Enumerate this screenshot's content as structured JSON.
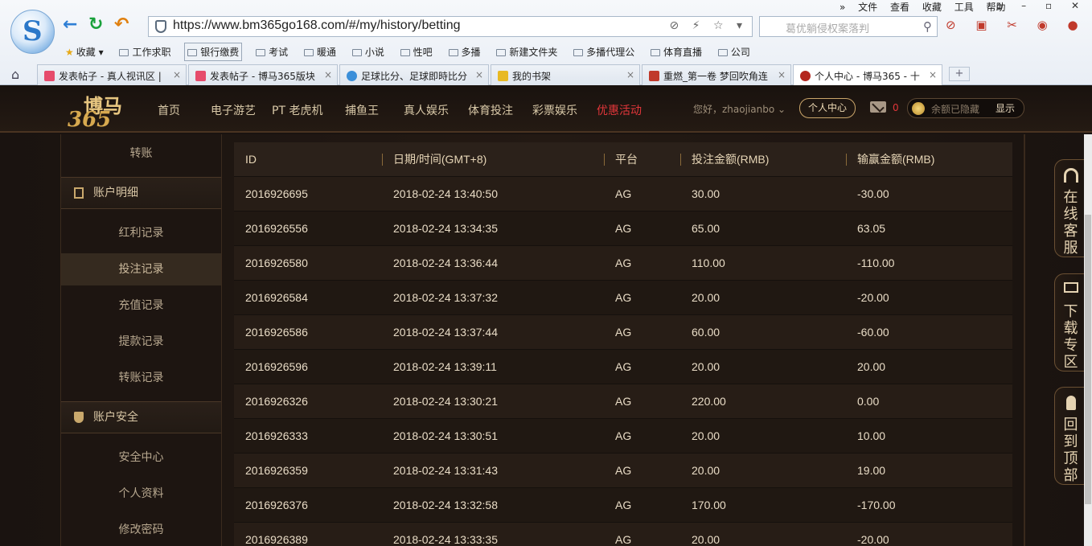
{
  "browser": {
    "url": "https://www.bm365go168.com/#/my/history/betting",
    "search_placeholder": "葛优躺侵权案落判",
    "menu": [
      "文件",
      "查看",
      "收藏",
      "工具",
      "帮助"
    ],
    "bookmarks_label": "收藏",
    "bookmarks": [
      "工作求职",
      "银行缴费",
      "考试",
      "暖通",
      "小说",
      "性吧",
      "多播",
      "新建文件夹",
      "多播代理公",
      "体育直播",
      "公司"
    ],
    "tabs": [
      {
        "title": "发表帖子 - 真人视讯区 |"
      },
      {
        "title": "发表帖子 - 博马365版块"
      },
      {
        "title": "足球比分、足球即時比分"
      },
      {
        "title": "我的书架"
      },
      {
        "title": "重燃_第一卷 梦回吹角连"
      },
      {
        "title": "个人中心 - 博马365 - 十"
      }
    ],
    "new_tab": "+"
  },
  "site": {
    "logo_top": "博马",
    "logo_bottom": "365",
    "nav": [
      "首页",
      "电子游艺",
      "PT 老虎机",
      "捕鱼王",
      "真人娱乐",
      "体育投注",
      "彩票娱乐",
      "优惠活动"
    ],
    "greeting": "您好，zhaojianbo",
    "personal_center": "个人中心",
    "mail_count": "0",
    "balance_hidden": "余额已隐藏",
    "show": "显示"
  },
  "sidebar": {
    "top_item": "转账",
    "section1": "账户明细",
    "section1_items": [
      "红利记录",
      "投注记录",
      "充值记录",
      "提款记录",
      "转账记录"
    ],
    "section2": "账户安全",
    "section2_items": [
      "安全中心",
      "个人资料",
      "修改密码"
    ]
  },
  "table": {
    "headers": [
      "ID",
      "日期/时间(GMT+8)",
      "平台",
      "投注金额(RMB)",
      "输赢金额(RMB)"
    ],
    "rows": [
      [
        "2016926695",
        "2018-02-24 13:40:50",
        "AG",
        "30.00",
        "-30.00"
      ],
      [
        "2016926556",
        "2018-02-24 13:34:35",
        "AG",
        "65.00",
        "63.05"
      ],
      [
        "2016926580",
        "2018-02-24 13:36:44",
        "AG",
        "110.00",
        "-110.00"
      ],
      [
        "2016926584",
        "2018-02-24 13:37:32",
        "AG",
        "20.00",
        "-20.00"
      ],
      [
        "2016926586",
        "2018-02-24 13:37:44",
        "AG",
        "60.00",
        "-60.00"
      ],
      [
        "2016926596",
        "2018-02-24 13:39:11",
        "AG",
        "20.00",
        "20.00"
      ],
      [
        "2016926326",
        "2018-02-24 13:30:21",
        "AG",
        "220.00",
        "0.00"
      ],
      [
        "2016926333",
        "2018-02-24 13:30:51",
        "AG",
        "20.00",
        "10.00"
      ],
      [
        "2016926359",
        "2018-02-24 13:31:43",
        "AG",
        "20.00",
        "19.00"
      ],
      [
        "2016926376",
        "2018-02-24 13:32:58",
        "AG",
        "170.00",
        "-170.00"
      ],
      [
        "2016926389",
        "2018-02-24 13:33:35",
        "AG",
        "20.00",
        "-20.00"
      ]
    ]
  },
  "float_buttons": {
    "service": "在线客服",
    "download": "下载专区",
    "top": "回到顶部"
  }
}
